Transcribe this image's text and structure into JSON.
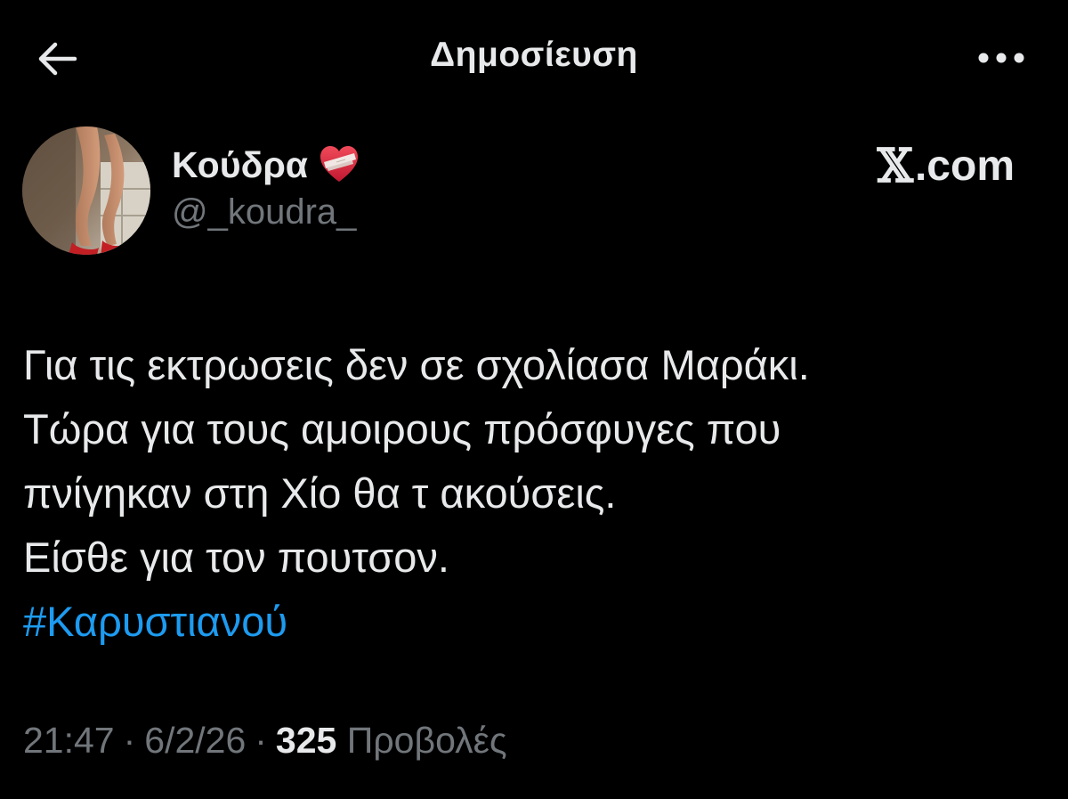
{
  "header": {
    "title": "Δημοσίευση",
    "back_icon": "arrow-left-icon",
    "more_icon": "more-dots-icon"
  },
  "author": {
    "display_name": "Κούδρα",
    "handle": "@_koudra_",
    "badge_icon": "mending-heart-icon"
  },
  "brand": {
    "x_glyph": "𝕏",
    "suffix": ".com"
  },
  "tweet": {
    "lines": [
      "Για τις εκτρωσεις δεν σε σχολίασα Μαράκι.",
      "Τώρα για τους αμοιρους πρόσφυγες που",
      "πνίγηκαν στη Χίο θα τ ακούσεις.",
      "Είσθε για τον πουτσον."
    ],
    "hashtag": "#Καρυστιανού"
  },
  "meta": {
    "time": "21:47",
    "separator": "·",
    "date": "6/2/26",
    "views_count": "325",
    "views_label": "Προβολές"
  },
  "colors": {
    "background": "#000000",
    "text_primary": "#e7e9ea",
    "text_secondary": "#71767b",
    "link": "#1d9bf0"
  }
}
